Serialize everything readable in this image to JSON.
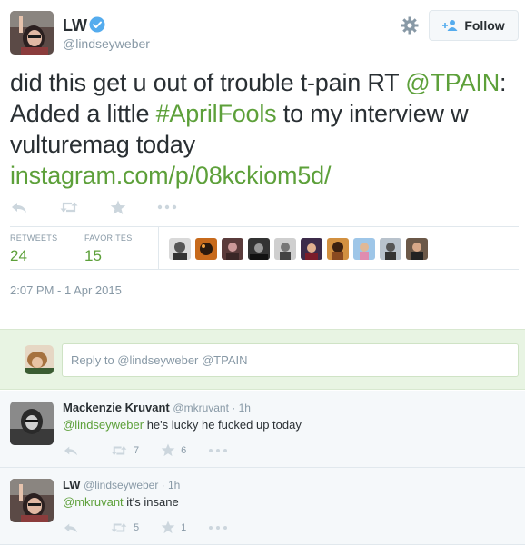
{
  "tweet": {
    "fullname": "LW",
    "screenname": "@lindseyweber",
    "follow_label": "Follow",
    "text_plain_1": "did this get u out of trouble t-pain RT ",
    "mention_tpain": "@TPAIN",
    "text_plain_2": ": Added a little ",
    "hashtag": "#AprilFools",
    "text_plain_3": " to my interview w vulturemag today ",
    "link": "instagram.com/p/08kckiom5d/",
    "retweets_label": "RETWEETS",
    "retweets_count": "24",
    "favorites_label": "FAVORITES",
    "favorites_count": "15",
    "timestamp": "2:07 PM - 1 Apr 2015"
  },
  "reply_box": {
    "placeholder": "Reply to @lindseyweber @TPAIN"
  },
  "replies": [
    {
      "name": "Mackenzie Kruvant",
      "handle": "@mkruvant · 1h",
      "mention": "@lindseyweber",
      "text": " he's lucky he fucked up today",
      "retweets": "7",
      "favorites": "6"
    },
    {
      "name": "LW",
      "handle": "@lindseyweber · 1h",
      "mention": "@mkruvant",
      "text": " it's insane",
      "retweets": "5",
      "favorites": "1"
    }
  ],
  "colors": {
    "accent": "#5da03a",
    "muted": "#8899a6",
    "text": "#292f33",
    "verified": "#55acee",
    "reply_box_bg": "#e8f4e3"
  },
  "icons": [
    "verified-icon",
    "gear-icon",
    "follow-person-icon",
    "reply-icon",
    "retweet-icon",
    "favorite-icon",
    "more-icon"
  ]
}
